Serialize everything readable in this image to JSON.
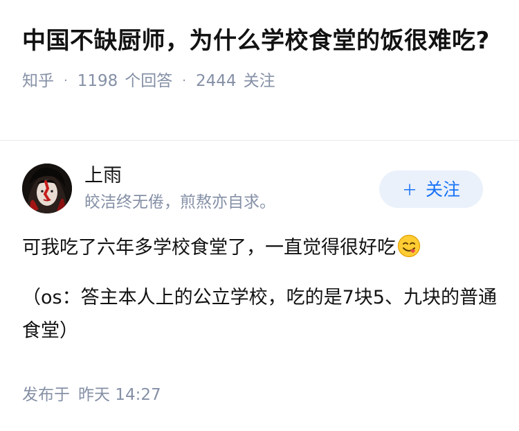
{
  "question": {
    "title": "中国不缺厨师，为什么学校食堂的饭很难吃?",
    "source": "知乎",
    "answer_count": "1198",
    "answer_label": "个回答",
    "follower_count": "2444",
    "follower_label": "关注"
  },
  "author": {
    "name": "上雨",
    "bio": "皎洁终无倦，煎熬亦自求。",
    "avatar_icon": "avatar-image",
    "follow_label": "关注",
    "follow_icon": "plus-icon"
  },
  "answer": {
    "paragraph_1": "可我吃了六年多学校食堂了，一直觉得很好吃",
    "emoji_icon": "yum-face-emoji",
    "paragraph_2": "（os：答主本人上的公立学校，吃的是7块5、九块的普通食堂）"
  },
  "publish": {
    "label": "发布于",
    "time": "昨天 14:27"
  },
  "colors": {
    "primary_text": "#121212",
    "secondary_text": "#8590a6",
    "accent_blue": "#1772f6",
    "button_bg": "#eaf1fb",
    "emoji_yellow": "#ffcc33"
  }
}
